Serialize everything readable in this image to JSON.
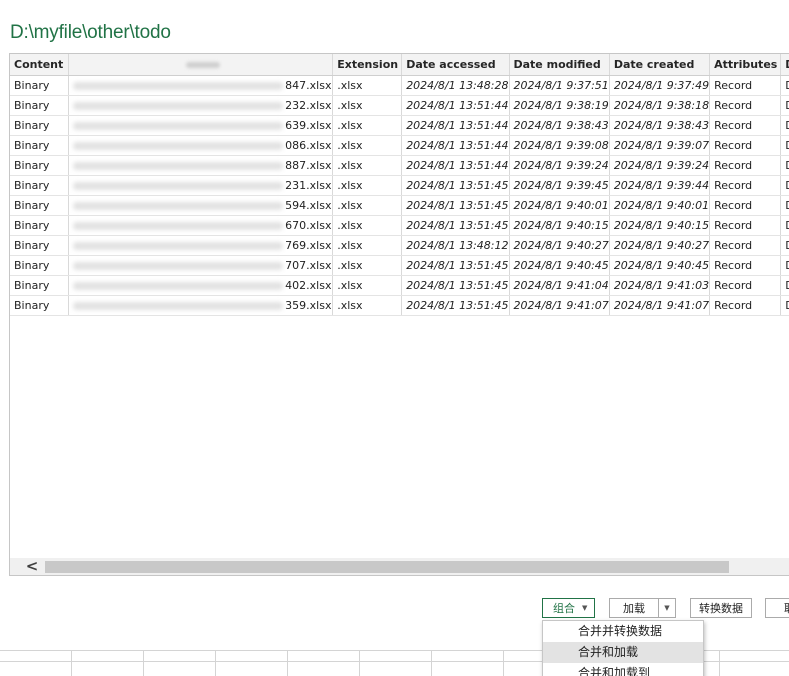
{
  "window": {
    "path": "D:\\myfile\\other\\todo"
  },
  "table": {
    "headers": {
      "content": "Content",
      "extension": "Extension",
      "date_accessed": "Date accessed",
      "date_modified": "Date modified",
      "date_created": "Date created",
      "attributes": "Attributes",
      "folder_path": "D"
    },
    "rows": [
      {
        "content": "Binary",
        "name_suffix": "847.xlsx",
        "extension": ".xlsx",
        "date_accessed": "2024/8/1 13:48:28",
        "date_modified": "2024/8/1 9:37:51",
        "date_created": "2024/8/1 9:37:49",
        "attributes": "Record",
        "folder_path": "D"
      },
      {
        "content": "Binary",
        "name_suffix": "232.xlsx",
        "extension": ".xlsx",
        "date_accessed": "2024/8/1 13:51:44",
        "date_modified": "2024/8/1 9:38:19",
        "date_created": "2024/8/1 9:38:18",
        "attributes": "Record",
        "folder_path": "D"
      },
      {
        "content": "Binary",
        "name_suffix": "639.xlsx",
        "extension": ".xlsx",
        "date_accessed": "2024/8/1 13:51:44",
        "date_modified": "2024/8/1 9:38:43",
        "date_created": "2024/8/1 9:38:43",
        "attributes": "Record",
        "folder_path": "D"
      },
      {
        "content": "Binary",
        "name_suffix": "086.xlsx",
        "extension": ".xlsx",
        "date_accessed": "2024/8/1 13:51:44",
        "date_modified": "2024/8/1 9:39:08",
        "date_created": "2024/8/1 9:39:07",
        "attributes": "Record",
        "folder_path": "D"
      },
      {
        "content": "Binary",
        "name_suffix": "887.xlsx",
        "extension": ".xlsx",
        "date_accessed": "2024/8/1 13:51:44",
        "date_modified": "2024/8/1 9:39:24",
        "date_created": "2024/8/1 9:39:24",
        "attributes": "Record",
        "folder_path": "D"
      },
      {
        "content": "Binary",
        "name_suffix": "231.xlsx",
        "extension": ".xlsx",
        "date_accessed": "2024/8/1 13:51:45",
        "date_modified": "2024/8/1 9:39:45",
        "date_created": "2024/8/1 9:39:44",
        "attributes": "Record",
        "folder_path": "D"
      },
      {
        "content": "Binary",
        "name_suffix": "594.xlsx",
        "extension": ".xlsx",
        "date_accessed": "2024/8/1 13:51:45",
        "date_modified": "2024/8/1 9:40:01",
        "date_created": "2024/8/1 9:40:01",
        "attributes": "Record",
        "folder_path": "D"
      },
      {
        "content": "Binary",
        "name_suffix": "670.xlsx",
        "extension": ".xlsx",
        "date_accessed": "2024/8/1 13:51:45",
        "date_modified": "2024/8/1 9:40:15",
        "date_created": "2024/8/1 9:40:15",
        "attributes": "Record",
        "folder_path": "D"
      },
      {
        "content": "Binary",
        "name_suffix": "769.xlsx",
        "extension": ".xlsx",
        "date_accessed": "2024/8/1 13:48:12",
        "date_modified": "2024/8/1 9:40:27",
        "date_created": "2024/8/1 9:40:27",
        "attributes": "Record",
        "folder_path": "D"
      },
      {
        "content": "Binary",
        "name_suffix": "707.xlsx",
        "extension": ".xlsx",
        "date_accessed": "2024/8/1 13:51:45",
        "date_modified": "2024/8/1 9:40:45",
        "date_created": "2024/8/1 9:40:45",
        "attributes": "Record",
        "folder_path": "D"
      },
      {
        "content": "Binary",
        "name_suffix": "402.xlsx",
        "extension": ".xlsx",
        "date_accessed": "2024/8/1 13:51:45",
        "date_modified": "2024/8/1 9:41:04",
        "date_created": "2024/8/1 9:41:03",
        "attributes": "Record",
        "folder_path": "D"
      },
      {
        "content": "Binary",
        "name_suffix": "359.xlsx",
        "extension": ".xlsx",
        "date_accessed": "2024/8/1 13:51:45",
        "date_modified": "2024/8/1 9:41:07",
        "date_created": "2024/8/1 9:41:07",
        "attributes": "Record",
        "folder_path": "D"
      }
    ]
  },
  "scrollbar": {
    "left_arrow": "<"
  },
  "buttons": {
    "combine": "组合",
    "combine_caret": "▼",
    "load": "加载",
    "load_caret": "▼",
    "transform": "转换数据",
    "cancel": "取"
  },
  "combine_menu": {
    "items": [
      {
        "label": "合并并转换数据"
      },
      {
        "label": "合并和加载"
      },
      {
        "label": "合并和加载到"
      }
    ],
    "active_index": 1
  },
  "colors": {
    "accent": "#217346"
  }
}
